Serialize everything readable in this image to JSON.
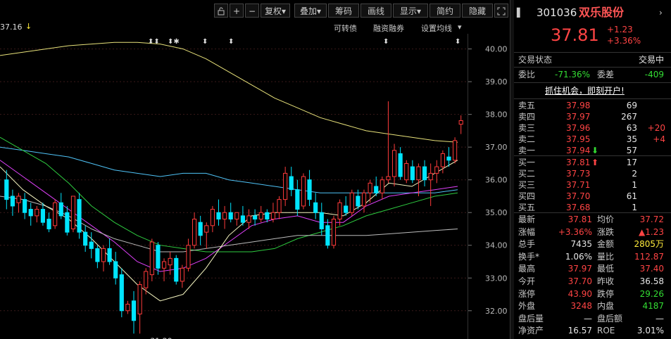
{
  "toolbar": {
    "buttons": [
      "复权",
      "叠加",
      "筹码",
      "画线",
      "显示",
      "简约",
      "隐藏"
    ],
    "plus": "+",
    "minus": "−"
  },
  "subbar": {
    "left_label": "37.16",
    "right_items": [
      "可转债",
      "融资融券",
      "设置均线"
    ]
  },
  "chart_data": {
    "type": "candlestick",
    "y_ticks": [
      "40.00",
      "39.00",
      "38.00",
      "37.00",
      "36.00",
      "35.00",
      "34.00",
      "33.00",
      "32.00"
    ],
    "ylim": [
      31.2,
      40.4
    ],
    "low_annotation": "31.29",
    "candles": [
      [
        36.0,
        36.3,
        35.1,
        35.4
      ],
      [
        35.5,
        35.7,
        34.9,
        35.2
      ],
      [
        35.3,
        35.6,
        35.0,
        35.5
      ],
      [
        35.4,
        35.6,
        34.8,
        35.0
      ],
      [
        35.1,
        35.3,
        34.6,
        34.9
      ],
      [
        34.9,
        35.2,
        34.7,
        35.1
      ],
      [
        35.1,
        35.3,
        34.6,
        34.7
      ],
      [
        34.8,
        35.0,
        34.4,
        34.5
      ],
      [
        34.6,
        35.4,
        34.5,
        35.3
      ],
      [
        35.3,
        35.6,
        34.8,
        34.9
      ],
      [
        35.0,
        35.2,
        34.3,
        34.4
      ],
      [
        34.5,
        35.5,
        34.4,
        35.5
      ],
      [
        35.4,
        35.6,
        34.2,
        34.4
      ],
      [
        34.4,
        34.6,
        33.8,
        34.0
      ],
      [
        34.1,
        34.4,
        33.6,
        33.9
      ],
      [
        33.9,
        34.0,
        33.3,
        33.5
      ],
      [
        33.5,
        34.0,
        33.2,
        33.9
      ],
      [
        33.9,
        34.2,
        33.4,
        33.5
      ],
      [
        33.5,
        33.8,
        32.8,
        33.0
      ],
      [
        33.1,
        33.3,
        31.8,
        32.0
      ],
      [
        32.0,
        32.3,
        31.9,
        32.2
      ],
      [
        32.3,
        32.6,
        31.3,
        31.7
      ],
      [
        31.9,
        32.9,
        31.3,
        32.8
      ],
      [
        32.7,
        33.3,
        32.5,
        33.2
      ],
      [
        33.1,
        34.2,
        32.9,
        34.1
      ],
      [
        34.0,
        34.1,
        33.1,
        33.3
      ],
      [
        33.3,
        33.6,
        32.9,
        33.5
      ],
      [
        33.4,
        33.8,
        33.1,
        33.6
      ],
      [
        33.6,
        33.7,
        32.8,
        32.9
      ],
      [
        32.9,
        33.4,
        32.7,
        33.3
      ],
      [
        33.3,
        34.2,
        33.2,
        34.0
      ],
      [
        34.0,
        35.0,
        33.9,
        34.8
      ],
      [
        34.7,
        34.9,
        34.0,
        34.3
      ],
      [
        34.4,
        34.7,
        33.9,
        34.6
      ],
      [
        34.6,
        35.2,
        34.4,
        35.1
      ],
      [
        35.0,
        35.4,
        34.6,
        34.8
      ],
      [
        34.8,
        35.2,
        34.5,
        35.0
      ],
      [
        35.0,
        35.3,
        34.7,
        34.8
      ],
      [
        34.8,
        35.0,
        34.6,
        35.0
      ],
      [
        34.9,
        35.2,
        34.6,
        34.7
      ],
      [
        34.7,
        35.1,
        34.5,
        34.9
      ],
      [
        34.9,
        35.1,
        34.6,
        34.8
      ],
      [
        34.8,
        35.2,
        34.7,
        35.0
      ],
      [
        35.0,
        35.1,
        34.7,
        34.8
      ],
      [
        34.8,
        35.3,
        34.7,
        35.0
      ],
      [
        35.0,
        35.5,
        34.8,
        35.4
      ],
      [
        35.4,
        36.4,
        35.2,
        36.2
      ],
      [
        36.1,
        36.4,
        35.5,
        35.7
      ],
      [
        35.7,
        36.0,
        34.9,
        35.1
      ],
      [
        35.2,
        36.2,
        35.1,
        36.1
      ],
      [
        36.0,
        36.3,
        35.2,
        35.4
      ],
      [
        35.3,
        35.6,
        34.8,
        35.0
      ],
      [
        35.0,
        35.3,
        34.3,
        34.5
      ],
      [
        34.6,
        34.8,
        33.9,
        34.0
      ],
      [
        34.0,
        34.9,
        33.9,
        34.8
      ],
      [
        34.8,
        35.4,
        34.6,
        35.3
      ],
      [
        35.2,
        35.5,
        34.9,
        35.0
      ],
      [
        35.0,
        35.7,
        34.9,
        35.6
      ],
      [
        35.5,
        35.7,
        35.1,
        35.2
      ],
      [
        35.2,
        35.7,
        35.0,
        35.6
      ],
      [
        35.6,
        36.0,
        35.3,
        35.9
      ],
      [
        35.8,
        36.1,
        35.5,
        35.6
      ],
      [
        35.6,
        36.1,
        35.4,
        36.0
      ],
      [
        36.0,
        38.4,
        35.9,
        36.1
      ],
      [
        36.1,
        37.1,
        35.8,
        36.9
      ],
      [
        36.8,
        37.0,
        36.0,
        36.1
      ],
      [
        36.0,
        36.6,
        35.9,
        36.5
      ],
      [
        36.4,
        36.6,
        35.9,
        36.0
      ],
      [
        36.0,
        36.5,
        35.5,
        36.4
      ],
      [
        36.4,
        36.6,
        35.8,
        36.0
      ],
      [
        36.0,
        36.5,
        35.2,
        36.2
      ],
      [
        36.2,
        36.6,
        35.9,
        36.4
      ],
      [
        36.4,
        36.9,
        36.2,
        36.8
      ],
      [
        36.7,
        37.0,
        36.4,
        36.6
      ],
      [
        36.6,
        37.3,
        36.5,
        37.2
      ],
      [
        37.7,
        37.97,
        37.4,
        37.81
      ]
    ],
    "ma_lines": {
      "yellow": [
        39.8,
        39.9,
        40.0,
        40.1,
        40.15,
        40.2,
        40.2,
        40.15,
        40.0,
        39.7,
        39.3,
        38.9,
        38.5,
        38.2,
        37.9,
        37.7,
        37.5,
        37.4,
        37.3,
        37.2,
        37.15
      ],
      "cyan": [
        37.0,
        36.9,
        36.8,
        36.7,
        36.5,
        36.3,
        36.2,
        36.1,
        36.2,
        36.2,
        36.0,
        35.9,
        35.8,
        35.7,
        35.6,
        35.6,
        35.6,
        35.6,
        35.6,
        35.6,
        35.7
      ],
      "green": [
        37.3,
        36.9,
        36.5,
        35.9,
        35.2,
        34.7,
        34.3,
        34.0,
        33.9,
        33.8,
        33.8,
        33.8,
        33.9,
        34.2,
        34.4,
        34.6,
        34.9,
        35.1,
        35.3,
        35.5,
        35.6
      ],
      "magenta": [
        36.6,
        36.1,
        35.6,
        35.1,
        34.6,
        34.1,
        33.5,
        33.2,
        33.3,
        33.6,
        34.1,
        34.6,
        34.8,
        34.9,
        34.7,
        34.7,
        35.2,
        35.5,
        35.6,
        35.7,
        35.8
      ],
      "white": [
        35.5,
        35.4,
        35.2,
        34.9,
        34.5,
        34.2,
        34.0,
        33.8,
        33.8,
        33.9,
        34.0,
        34.1,
        34.2,
        34.3,
        34.3,
        34.3,
        34.3,
        34.35,
        34.4,
        34.45,
        34.5
      ],
      "light": [
        36.4,
        35.7,
        35.2,
        34.8,
        34.2,
        33.5,
        32.8,
        32.3,
        32.5,
        33.3,
        34.3,
        34.9,
        35.0,
        35.0,
        35.0,
        34.9,
        35.3,
        35.9,
        35.8,
        36.2,
        36.6
      ]
    },
    "markers": [
      "⬍⬍",
      "⬍✱",
      "⬍",
      "⬍",
      "⬍",
      "⬍"
    ]
  },
  "panel": {
    "code": "301036",
    "name": "双乐股份",
    "price": "37.81",
    "change": "+1.23",
    "change_pct": "+3.36%",
    "status_label": "交易状态",
    "status_value": "交易中",
    "weibi_label": "委比",
    "weibi_value": "-71.36%",
    "weicha_label": "委差",
    "weicha_value": "-409",
    "promo": "抓住机会，即刻开户!",
    "asks": [
      {
        "label": "卖五",
        "price": "37.98",
        "vol": "69",
        "delta": ""
      },
      {
        "label": "卖四",
        "price": "37.97",
        "vol": "267",
        "delta": ""
      },
      {
        "label": "卖三",
        "price": "37.96",
        "vol": "63",
        "delta": "+20"
      },
      {
        "label": "卖二",
        "price": "37.95",
        "vol": "35",
        "delta": "+4"
      },
      {
        "label": "卖一",
        "price": "37.94",
        "vol": "57",
        "delta": ""
      }
    ],
    "bids": [
      {
        "label": "买一",
        "price": "37.81",
        "vol": "17"
      },
      {
        "label": "买二",
        "price": "37.73",
        "vol": "2"
      },
      {
        "label": "买三",
        "price": "37.71",
        "vol": "1"
      },
      {
        "label": "买四",
        "price": "37.70",
        "vol": "61"
      },
      {
        "label": "买五",
        "price": "37.68",
        "vol": "1"
      }
    ],
    "stats": [
      {
        "l1": "最新",
        "v1": "37.81",
        "l2": "均价",
        "v2": "37.72"
      },
      {
        "l1": "涨幅",
        "v1": "+3.36%",
        "l2": "涨跌",
        "v2": "▲1.23"
      },
      {
        "l1": "总手",
        "v1": "7435",
        "l2": "金额",
        "v2": "2805万"
      },
      {
        "l1": "换手*",
        "v1": "1.06%",
        "l2": "量比",
        "v2": "112.87"
      },
      {
        "l1": "最高",
        "v1": "37.97",
        "l2": "最低",
        "v2": "37.40"
      },
      {
        "l1": "今开",
        "v1": "37.70",
        "l2": "昨收",
        "v2": "36.58"
      },
      {
        "l1": "涨停",
        "v1": "43.90",
        "l2": "跌停",
        "v2": "29.26"
      },
      {
        "l1": "外盘",
        "v1": "3248",
        "l2": "内盘",
        "v2": "4187"
      },
      {
        "l1": "盘后量",
        "v1": "—",
        "l2": "盘后额",
        "v2": "—"
      },
      {
        "l1": "净资产",
        "v1": "16.57",
        "l2": "ROE",
        "v2": "3.01%"
      }
    ]
  }
}
